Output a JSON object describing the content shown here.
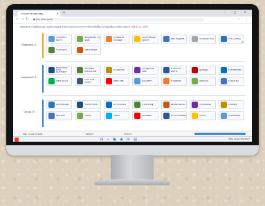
{
  "browser": {
    "tab_title": "ระบบสารสนเทศ สพฐ.",
    "url": "● ssm.obec.go.th",
    "new_tab": "+",
    "window_controls": "–  ▢  ✕"
  },
  "marquee": {
    "text": "Welcome ! ยินดีต้อนรับสู่ ระบบสารสนเทศ สำนักงานคณะกรรมการการศึกษาขั้นพื้นฐาน ข้อมูลเพื่อการบริหารจัดการ ",
    "date": "วันที่ 5 ก.ย. 2567"
  },
  "sections": [
    {
      "label": "Programs ①",
      "color": "orange",
      "tiles": [
        {
          "text": "ระบบบริหารจัดการ",
          "color": "#5b9bd5"
        },
        {
          "text": "ข้อมูลนักเรียน รายบุคคล",
          "color": "#70ad47"
        },
        {
          "text": "ระบบติดตาม ประเมินผล",
          "color": "#ed7d31"
        },
        {
          "text": "ระบบสารสนเทศ บุคลากร",
          "color": "#ffc000"
        },
        {
          "text": "DMC ข้อมูลสถิติ",
          "color": "#4472c4"
        },
        {
          "text": "ระบบงบประมาณ",
          "color": "#a5a5a5"
        },
        {
          "text": "ระบบ e-Office",
          "color": "#2e75b6"
        },
        {
          "text": "ระบบรายงาน",
          "color": "#548235"
        },
        {
          "text": "โครงการพิเศษ",
          "color": "#c55a11"
        }
      ]
    },
    {
      "label": "Important ②",
      "color": "blue",
      "tiles": [
        {
          "text": "EDUCATION DATA PLATFORM",
          "color": "#1f4e79"
        },
        {
          "text": "NATIONAL EDUCATION",
          "color": "#538135"
        },
        {
          "text": "ระบบคัดกรอง",
          "color": "#bf9000"
        },
        {
          "text": "ระบบดูแลช่วยเหลือ",
          "color": "#7030a0"
        },
        {
          "text": "ระบบประกันคุณภาพ",
          "color": "#2f5597"
        },
        {
          "text": "ศูนย์ข้อมูล",
          "color": "#c00000"
        },
        {
          "text": "ระบบรับนักเรียน",
          "color": "#0070c0"
        },
        {
          "text": "OBEC Smart",
          "color": "#00b050"
        },
        {
          "text": "DOC ระบบเอกสาร",
          "color": "#44546a"
        },
        {
          "text": "OBEC ONE",
          "color": "#ff0000"
        },
        {
          "text": "ระบบบริการ",
          "color": "#5b9bd5"
        },
        {
          "text": "ระบบติดตาม",
          "color": "#ed7d31"
        },
        {
          "text": "คลังความรู้",
          "color": "#70ad47"
        },
        {
          "text": "ระบบประชุม",
          "color": "#4472c4"
        }
      ]
    },
    {
      "label": "Group ③",
      "color": "blue",
      "tiles": [
        {
          "text": "LOI INTRANET",
          "color": "#2e75b6"
        },
        {
          "text": "ระบบสารบรรณ",
          "color": "#1f4e79"
        },
        {
          "text": "LOI Providers",
          "color": "#0070c0"
        },
        {
          "text": "นโยบาย สพฐ.",
          "color": "#548235"
        },
        {
          "text": "ห้องสมุด ออนไลน์",
          "color": "#c55a11"
        },
        {
          "text": "ระบบเงินเดือน",
          "color": "#7030a0"
        },
        {
          "text": "ระบบบัญชี",
          "color": "#bf9000"
        },
        {
          "text": "Web Mail",
          "color": "#4472c4"
        },
        {
          "text": "ระบบลา",
          "color": "#70ad47"
        },
        {
          "text": "CEEDA",
          "color": "#00b0f0"
        },
        {
          "text": "ระบบติดต่อ",
          "color": "#ff0000"
        },
        {
          "text": "ข่าวประชาสัมพันธ์",
          "color": "#2f5597"
        },
        {
          "text": "Kahoot",
          "color": "#ffc000"
        },
        {
          "text": "ระบบสนับสนุน",
          "color": "#5b9bd5"
        }
      ]
    }
  ],
  "footer": {
    "left": "สพฐ. ระบบสารสนเทศ",
    "mid1": "ติดต่อเรา",
    "mid2": "นโยบาย"
  },
  "taskbar": {
    "icons": "⊞ ⌕ ▣ ◉ ✉ ▤",
    "tray": "ENG  10:42  5/9/2567"
  }
}
